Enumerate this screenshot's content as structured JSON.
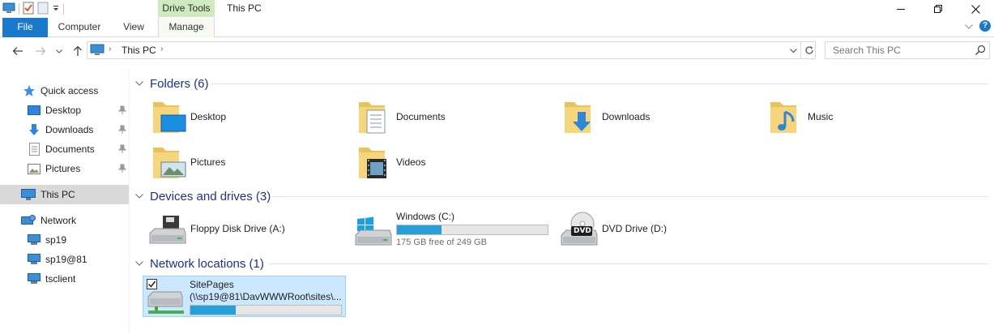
{
  "window": {
    "title": "This PC",
    "context_tab_group": "Drive Tools"
  },
  "ribbon": {
    "tabs": [
      "File",
      "Computer",
      "View",
      "Manage"
    ]
  },
  "address": {
    "segments": [
      "This PC"
    ],
    "search_placeholder": "Search This PC"
  },
  "nav_pane": {
    "quick_access": "Quick access",
    "quick_items": [
      "Desktop",
      "Downloads",
      "Documents",
      "Pictures"
    ],
    "this_pc": "This PC",
    "network": "Network",
    "network_items": [
      "sp19",
      "sp19@81",
      "tsclient"
    ]
  },
  "groups": {
    "folders": {
      "header": "Folders (6)",
      "items": [
        "Desktop",
        "Documents",
        "Downloads",
        "Music",
        "Pictures",
        "Videos"
      ]
    },
    "drives": {
      "header": "Devices and drives (3)",
      "items": [
        {
          "name": "Floppy Disk Drive (A:)"
        },
        {
          "name": "Windows (C:)",
          "free_text": "175 GB free of 249 GB",
          "used_fraction": 0.297
        },
        {
          "name": "DVD Drive (D:)",
          "badge": "DVD"
        }
      ]
    },
    "network": {
      "header": "Network locations (1)",
      "items": [
        {
          "name": "SitePages",
          "path": "(\\\\sp19@81\\DavWWWRoot\\sites\\...",
          "used_fraction": 0.3,
          "checked": true
        }
      ]
    }
  },
  "colors": {
    "accent": "#1979ca",
    "group_header": "#1e3287",
    "bar_fill": "#26a0da",
    "selection": "#cce8ff",
    "context_tab": "#cfeac0"
  }
}
